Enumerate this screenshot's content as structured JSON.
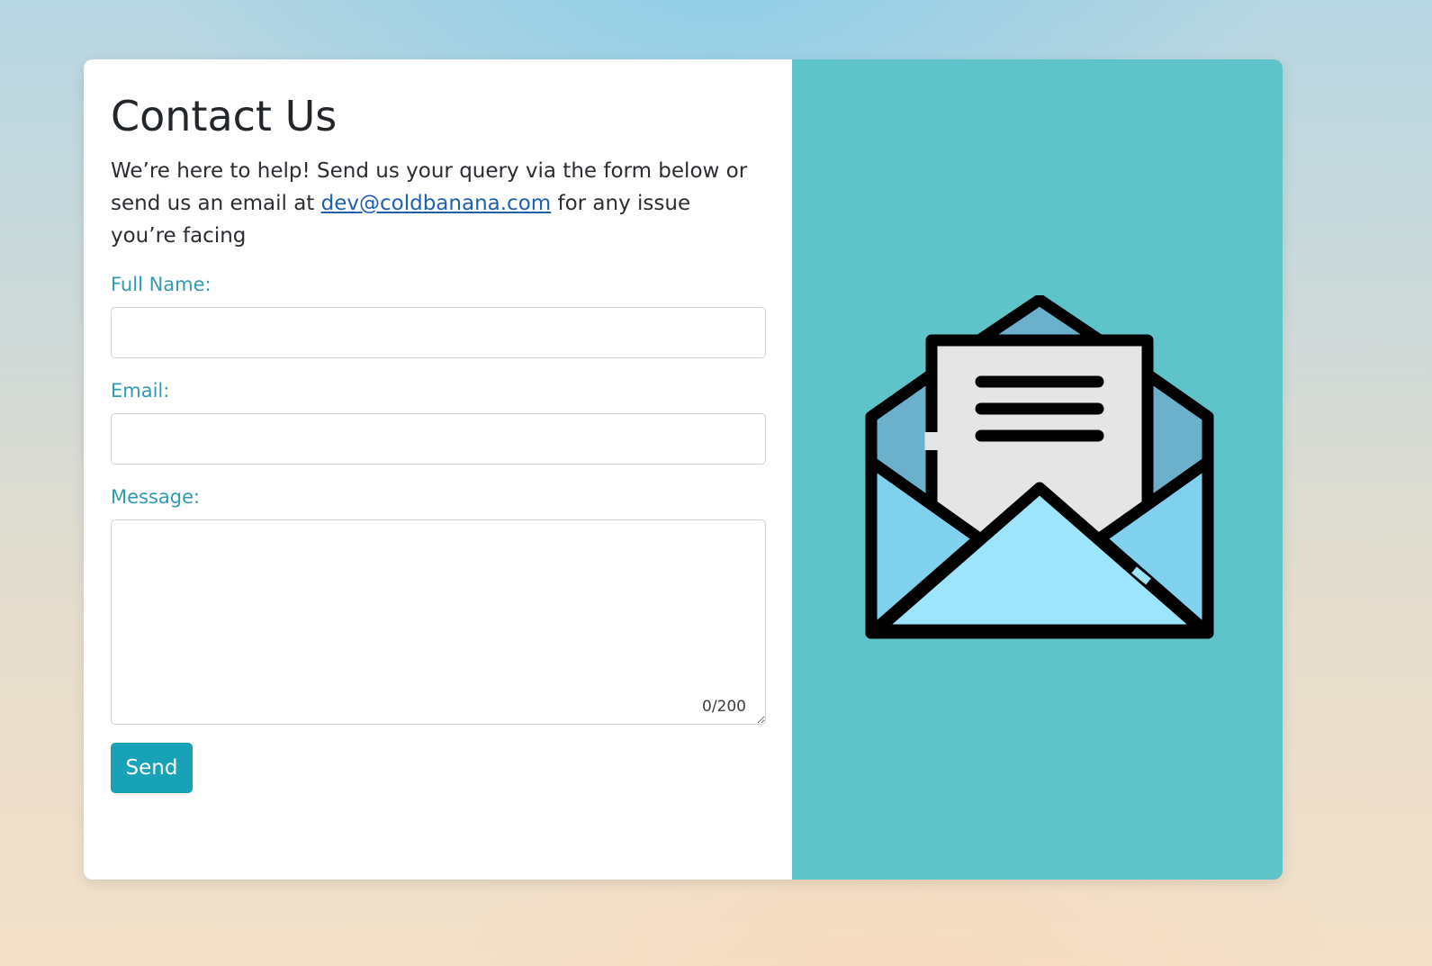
{
  "contact": {
    "title": "Contact Us",
    "intro_before": "We’re here to help! Send us your query via the form below or send us an email at ",
    "email_link": "dev@coldbanana.com",
    "intro_after": " for any issue you’re facing"
  },
  "form": {
    "full_name_label": "Full Name:",
    "full_name_value": "",
    "email_label": "Email:",
    "email_value": "",
    "message_label": "Message:",
    "message_value": "",
    "message_counter": "0/200",
    "send_label": "Send"
  },
  "illustration": {
    "icon": "open-envelope-icon"
  },
  "colors": {
    "accent": "#17a2b8",
    "label": "#2f9bb3",
    "image_panel": "#5ec4c9",
    "link": "#1f5fb0"
  }
}
